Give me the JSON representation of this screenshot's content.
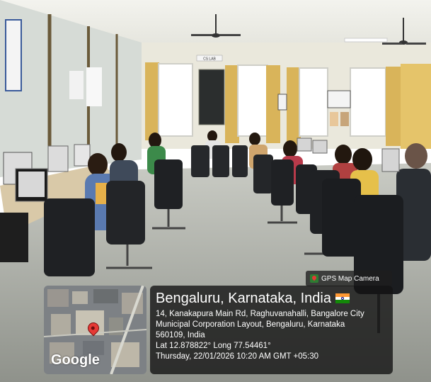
{
  "photo": {
    "signs": [
      "CS LAB"
    ],
    "camera_badge": "GPS Map Camera",
    "map_logo": "Google",
    "location": {
      "city_line": "Bengaluru, Karnataka, India",
      "address_lines": [
        "14, Kanakapura Main Rd, Raghuvanahalli, Bangalore City",
        "Municipal Corporation Layout, Bengaluru, Karnataka",
        "560109, India"
      ],
      "coordinates": "Lat 12.878822° Long 77.54461°",
      "timestamp": "Thursday, 22/01/2026 10:20 AM GMT +05:30"
    },
    "colors": {
      "wall": "#eae8dc",
      "floor": "#b9bcb5",
      "curtain": "#d9b45a",
      "chair": "#1f2124",
      "overlay": "#141414"
    },
    "icons": [
      "map-pin-icon",
      "india-flag-icon",
      "gps-camera-icon",
      "ceiling-fan-icon"
    ]
  }
}
